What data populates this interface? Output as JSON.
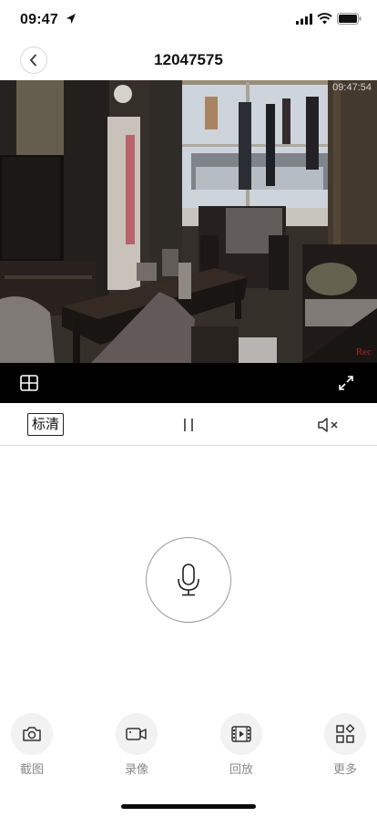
{
  "status": {
    "time": "09:47"
  },
  "nav": {
    "title": "12047575"
  },
  "video": {
    "timestamp": "09:47:54",
    "rec_label": "Rec"
  },
  "controls": {
    "quality_label": "标清"
  },
  "tools": {
    "screenshot": "截图",
    "record": "录像",
    "playback": "回放",
    "more": "更多"
  },
  "icons": {
    "location": "location-arrow-icon",
    "signal": "cellular-signal-icon",
    "wifi": "wifi-icon",
    "battery": "battery-icon",
    "back": "chevron-left-icon",
    "grid": "grid-icon",
    "fullscreen": "fullscreen-icon",
    "pause": "pause-icon",
    "mute": "speaker-muted-icon",
    "mic": "microphone-icon",
    "camera": "camera-icon",
    "video": "video-camera-icon",
    "playback": "film-play-icon",
    "more": "apps-icon"
  }
}
